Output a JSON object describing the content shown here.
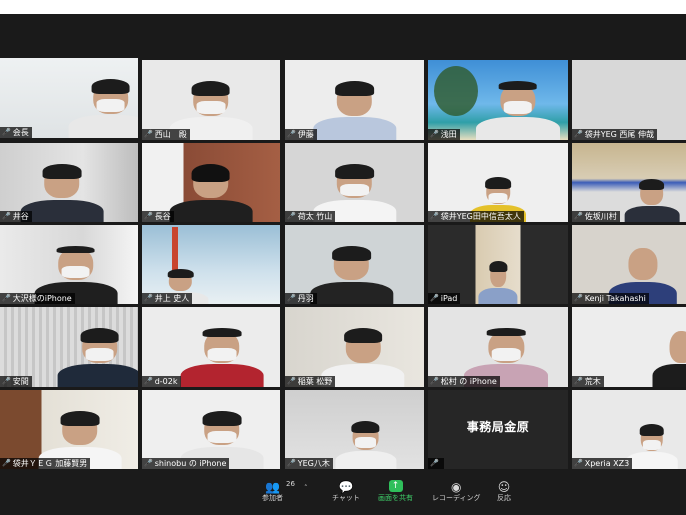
{
  "participants": [
    {
      "name": "会長"
    },
    {
      "name": "西山　殿"
    },
    {
      "name": "伊藤"
    },
    {
      "name": "浅田"
    },
    {
      "name": "袋井YEG 西尾 伸哉"
    },
    {
      "name": "井谷"
    },
    {
      "name": "長谷"
    },
    {
      "name": "荷太 竹山"
    },
    {
      "name": "袋井YEG田中信吾太人"
    },
    {
      "name": "佐坂川村"
    },
    {
      "name": "大沢様のiPhone"
    },
    {
      "name": "井上 史人"
    },
    {
      "name": "丹羽"
    },
    {
      "name": "iPad"
    },
    {
      "name": "Kenji Takahashi"
    },
    {
      "name": "安間"
    },
    {
      "name": "d-02k"
    },
    {
      "name": "稲葉 松野"
    },
    {
      "name": "松村 の iPhone"
    },
    {
      "name": "荒木"
    },
    {
      "name": "袋井ＹＥＧ 加藤賢男"
    },
    {
      "name": "shinobu の iPhone"
    },
    {
      "name": "YEG八木"
    },
    {
      "name": "",
      "display_name": "事務局金原"
    },
    {
      "name": "Xperia XZ3"
    }
  ],
  "toolbar": {
    "participants_label": "参加者",
    "participants_count": "26",
    "chat_label": "チャット",
    "share_label": "画面を共有",
    "record_label": "レコーディング",
    "reaction_label": "反応"
  },
  "colors": {
    "active_border": "#c9d94a",
    "muted_mic": "#e0383e",
    "share_green": "#2fbf5b"
  }
}
